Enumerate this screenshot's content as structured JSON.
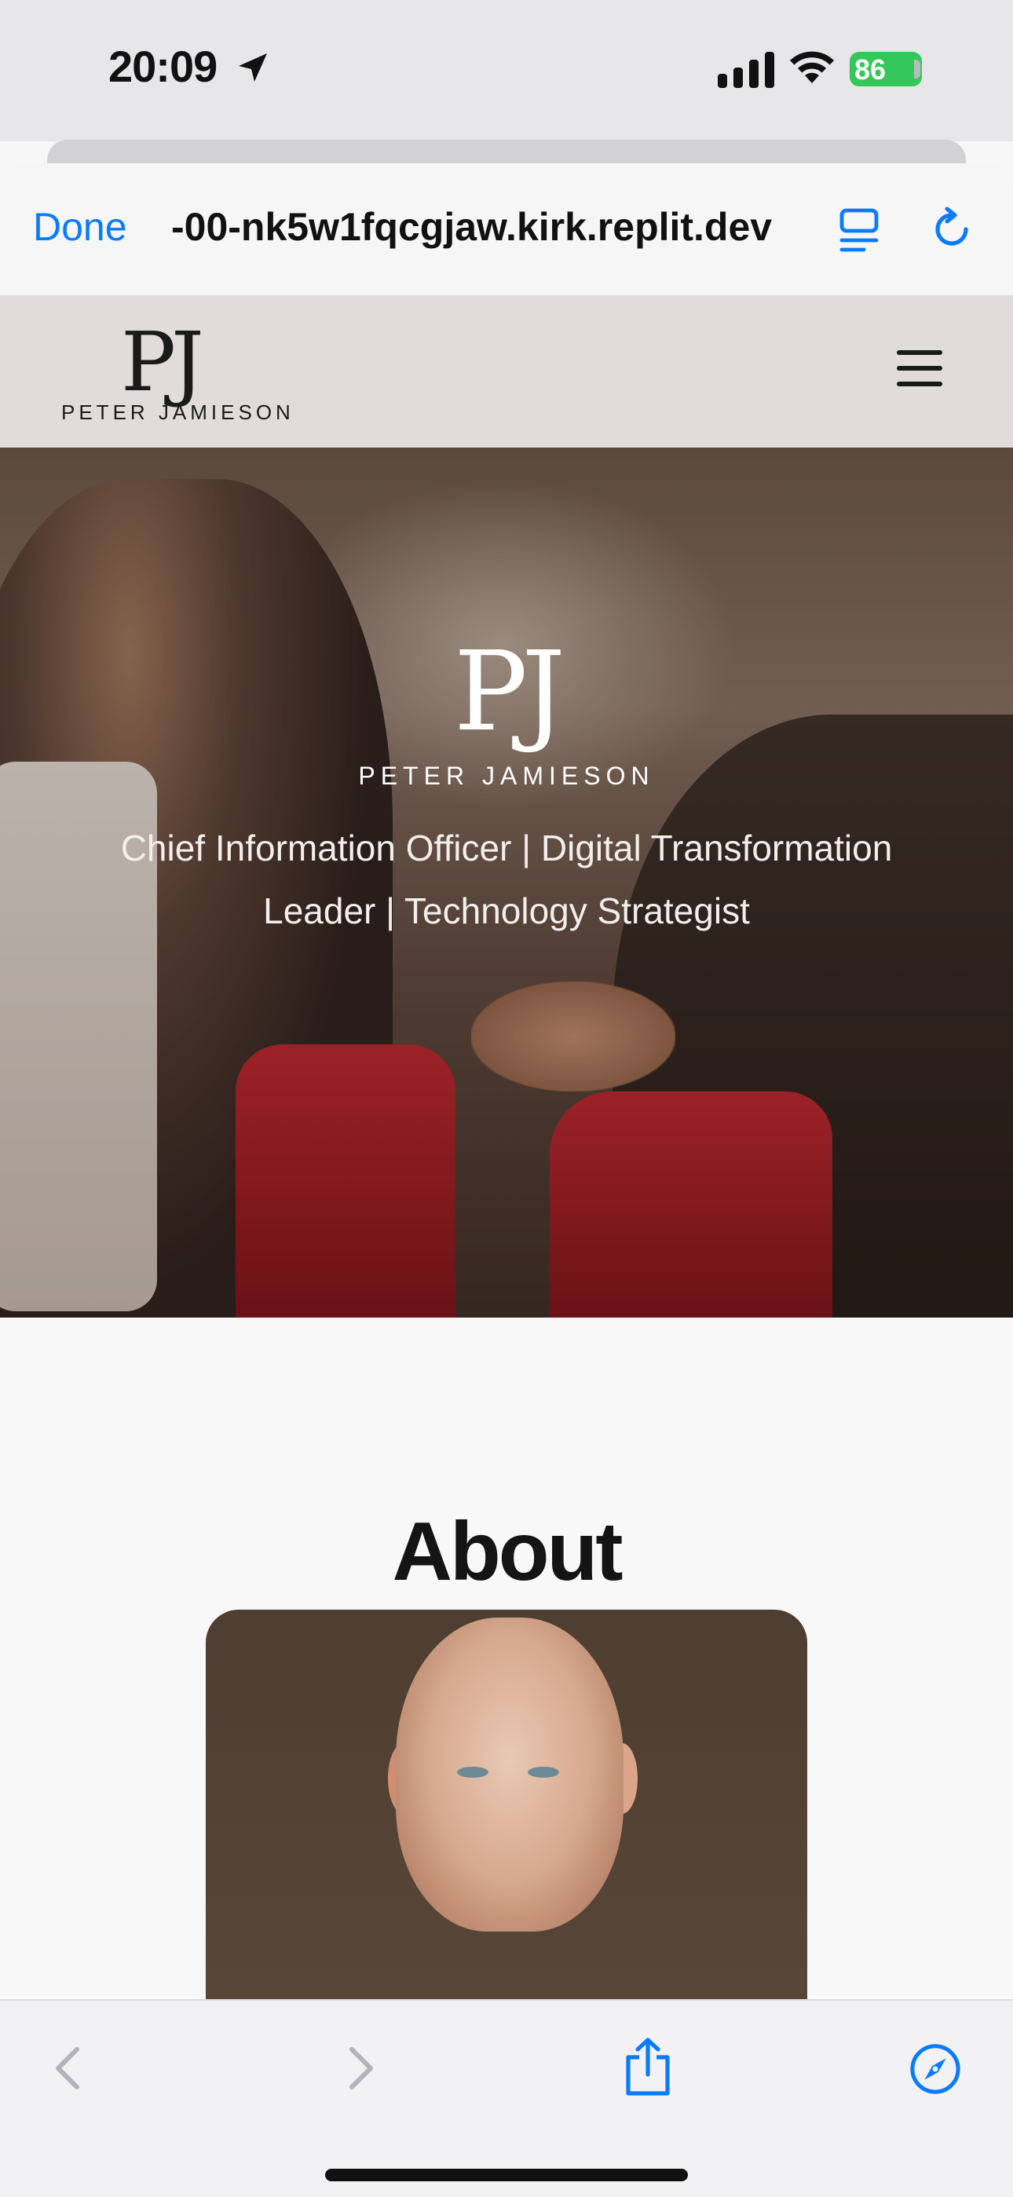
{
  "status_bar": {
    "time": "20:09",
    "battery_level": "86",
    "icons": [
      "location-arrow-icon",
      "cellular-signal-icon",
      "wifi-icon",
      "battery-charging-icon"
    ]
  },
  "browser": {
    "done_label": "Done",
    "url": "-00-nk5w1fqcgjaw.kirk.replit.dev",
    "accent_color": "#0a7aff",
    "icons": [
      "reader-view-icon",
      "reload-icon",
      "back-icon",
      "forward-icon",
      "share-icon",
      "compass-icon"
    ]
  },
  "site": {
    "header": {
      "logo_monogram": "PJ",
      "logo_name": "PETER JAMIESON"
    },
    "hero": {
      "monogram": "PJ",
      "name": "PETER JAMIESON",
      "tagline": "Chief Information Officer | Digital Transformation Leader | Technology Strategist"
    },
    "about": {
      "title": "About"
    }
  }
}
